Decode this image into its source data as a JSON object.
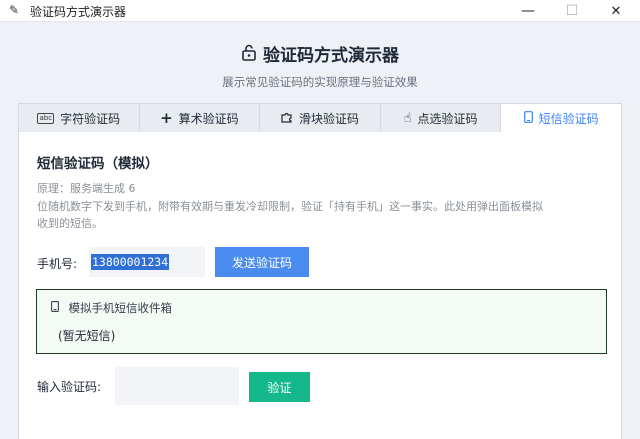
{
  "window": {
    "title": "验证码方式演示器",
    "minimize": "—",
    "maximize": "☐",
    "close": "✕"
  },
  "header": {
    "title": "验证码方式演示器",
    "subtitle": "展示常见验证码的实现原理与验证效果"
  },
  "tabs": [
    {
      "label": "字符验证码",
      "icon": "abc-icon",
      "active": false
    },
    {
      "label": "算术验证码",
      "icon": "plus-icon",
      "active": false
    },
    {
      "label": "滑块验证码",
      "icon": "puzzle-icon",
      "active": false
    },
    {
      "label": "点选验证码",
      "icon": "pointer-hand-icon",
      "active": false
    },
    {
      "label": "短信验证码",
      "icon": "phone-icon",
      "active": true
    }
  ],
  "panel": {
    "title": "短信验证码（模拟）",
    "description_line1": "原理：服务端生成 6",
    "description_line2": "位随机数字下发到手机，附带有效期与重发冷却限制，验证「持有手机」这一事实。此处用弹出面板模拟",
    "description_line3": "收到的短信。",
    "phone_label": "手机号:",
    "phone_value": "13800001234",
    "send_button": "发送验证码",
    "inbox_title": "模拟手机短信收件箱",
    "inbox_empty": "(暂无短信)",
    "code_label": "输入验证码:",
    "code_value": "",
    "verify_button": "验证"
  },
  "colors": {
    "accent": "#4a8bf0",
    "verify": "#14b88a",
    "inbox_bg": "#f3fbf4"
  }
}
